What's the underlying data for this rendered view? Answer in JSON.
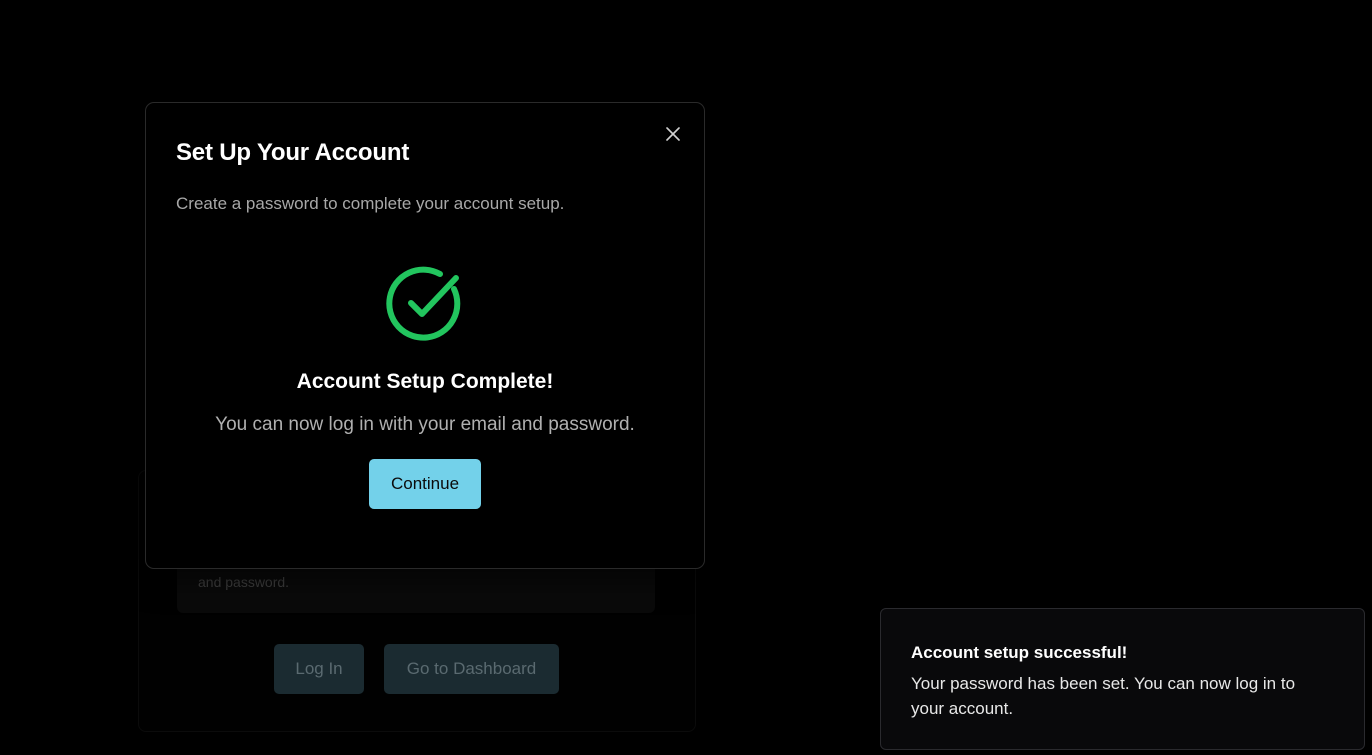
{
  "modal": {
    "title": "Set Up Your Account",
    "description": "Create a password to complete your account setup.",
    "success_title": "Account Setup Complete!",
    "success_message": "You can now log in with your email and password.",
    "continue_label": "Continue",
    "close_icon": "close-icon",
    "success_icon": "check-circle-icon",
    "accent_color": "#22c55e",
    "button_color": "#73d1ea"
  },
  "background_card": {
    "info_text": "and password.",
    "login_label": "Log In",
    "dashboard_label": "Go to Dashboard"
  },
  "toast": {
    "title": "Account setup successful!",
    "message": "Your password has been set. You can now log in to your account."
  }
}
